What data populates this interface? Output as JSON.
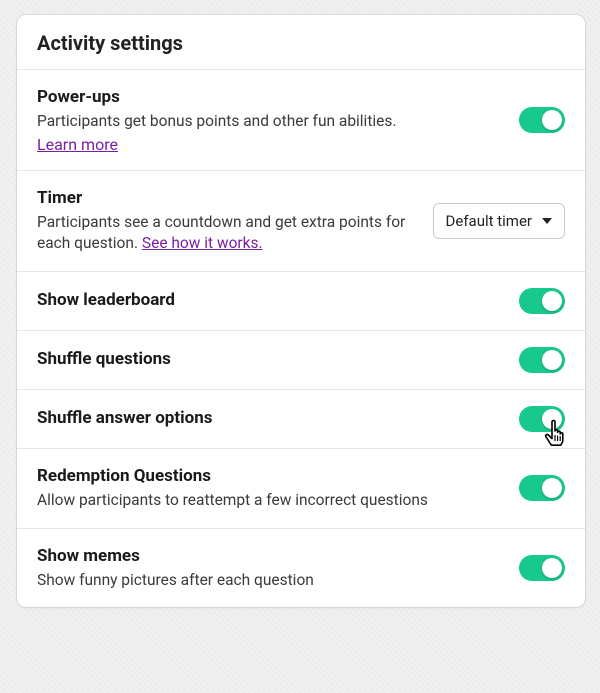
{
  "panel": {
    "title": "Activity settings"
  },
  "rows": {
    "powerups": {
      "title": "Power-ups",
      "desc": "Participants get bonus points and other fun abilities.",
      "link": "Learn more",
      "toggle": "on"
    },
    "timer": {
      "title": "Timer",
      "desc_prefix": "Participants see a countdown and get extra points for each question. ",
      "link": "See how it works.",
      "select_value": "Default timer"
    },
    "leaderboard": {
      "title": "Show leaderboard",
      "toggle": "on"
    },
    "shuffle_questions": {
      "title": "Shuffle questions",
      "toggle": "on"
    },
    "shuffle_answers": {
      "title": "Shuffle answer options",
      "toggle": "on"
    },
    "redemption": {
      "title": "Redemption Questions",
      "desc": "Allow participants to reattempt a few incorrect questions",
      "toggle": "on"
    },
    "memes": {
      "title": "Show memes",
      "desc": "Show funny pictures after each question",
      "toggle": "on"
    }
  }
}
